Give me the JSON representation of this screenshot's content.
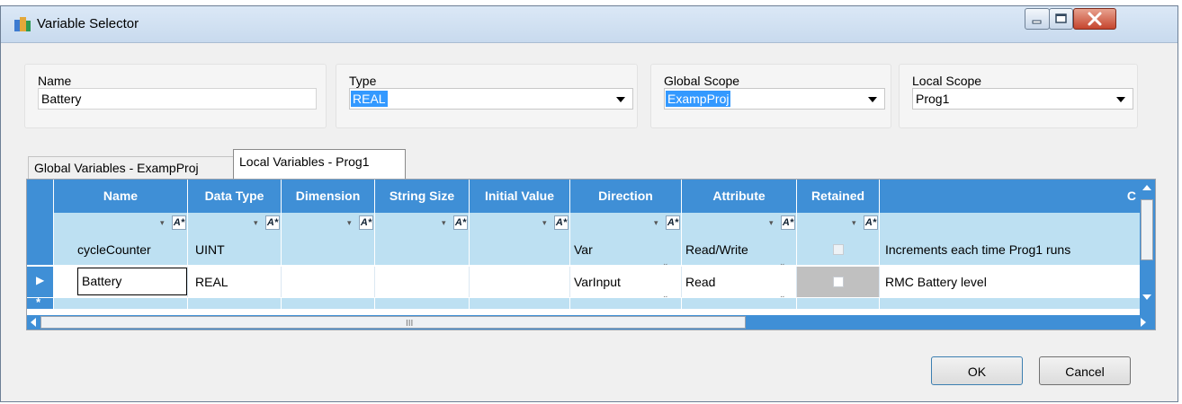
{
  "window": {
    "title": "Variable Selector"
  },
  "fields": {
    "name": {
      "label": "Name",
      "value": "Battery"
    },
    "type": {
      "label": "Type",
      "value": "REAL"
    },
    "global_scope": {
      "label": "Global Scope",
      "value": "ExampProj"
    },
    "local_scope": {
      "label": "Local Scope",
      "value": "Prog1"
    }
  },
  "tabs": [
    {
      "label": "Global Variables - ExampProj",
      "active": false
    },
    {
      "label": "Local Variables - Prog1",
      "active": true
    }
  ],
  "grid": {
    "columns": [
      "Name",
      "Data Type",
      "Dimension",
      "String Size",
      "Initial Value",
      "Direction",
      "Attribute",
      "Retained",
      "C"
    ],
    "rows": [
      {
        "name": "cycleCounter",
        "data_type": "UINT",
        "dimension": "",
        "string_size": "",
        "initial_value": "",
        "direction": "Var",
        "attribute": "Read/Write",
        "retained": false,
        "comment": "Increments each time Prog1 runs"
      },
      {
        "name": "Battery",
        "data_type": "REAL",
        "dimension": "",
        "string_size": "",
        "initial_value": "",
        "direction": "VarInput",
        "attribute": "Read",
        "retained": false,
        "comment": "RMC Battery level"
      }
    ],
    "new_row_marker": "*",
    "current_row_marker": "▶",
    "filter_icon": "A*",
    "scroll_grip": "III"
  },
  "buttons": {
    "ok": "OK",
    "cancel": "Cancel"
  },
  "colors": {
    "grid_header": "#3f8fd6",
    "grid_alt_row": "#bde0f2",
    "selection": "#3399ff"
  }
}
